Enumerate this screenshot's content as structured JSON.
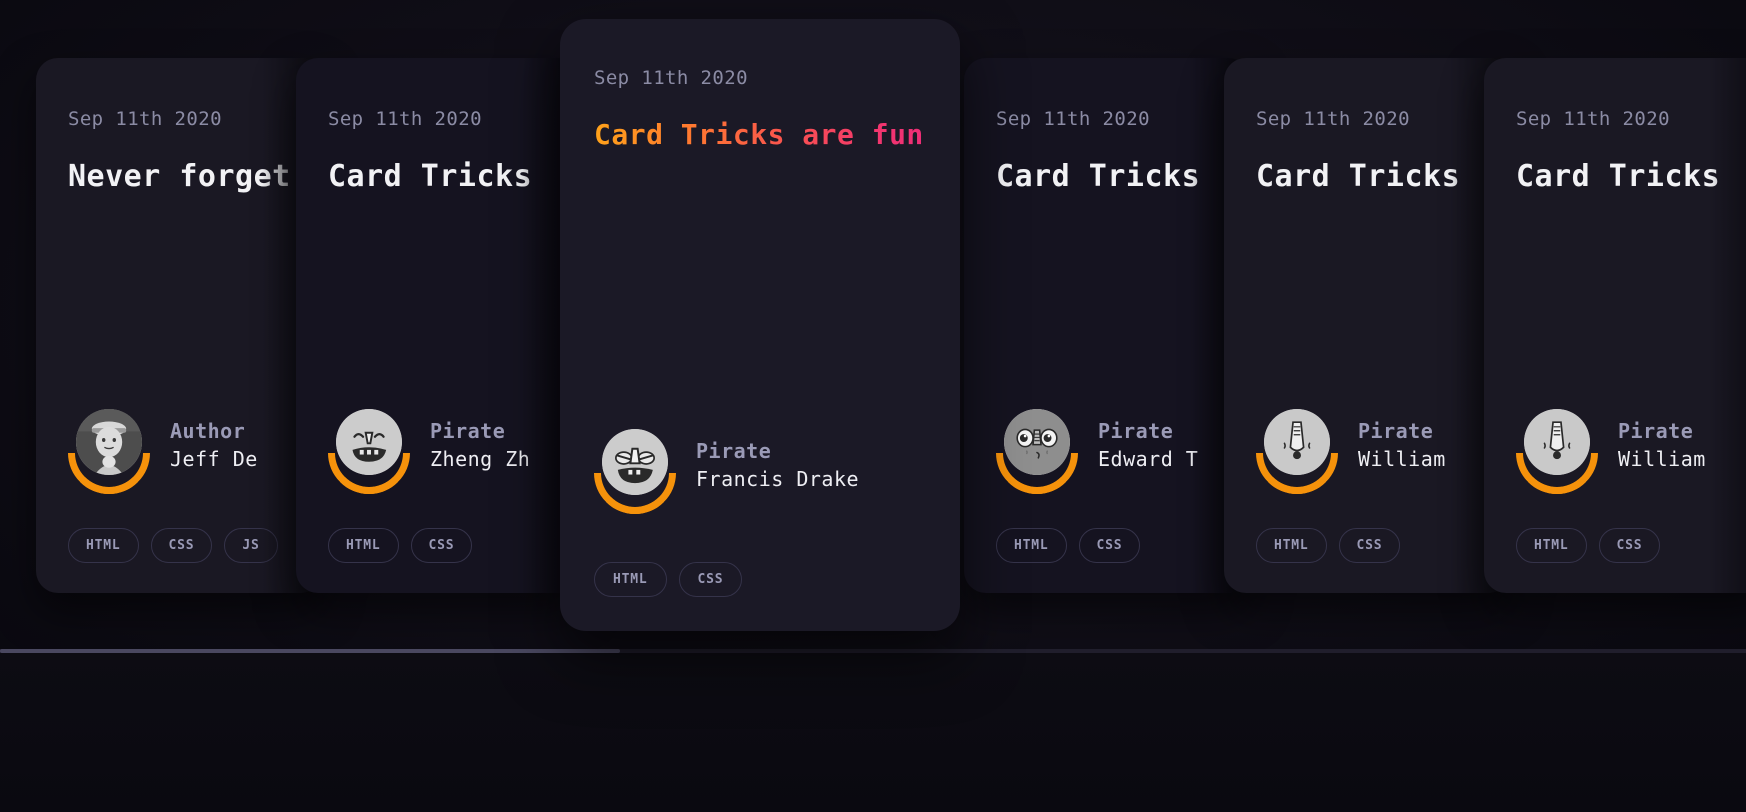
{
  "app": {
    "background_color": "#0a0910",
    "accent_color": "#f5920b",
    "card_color": "#1a1823",
    "active_card_color": "#1b1926",
    "title_gradient_from": "#ffa21a",
    "title_gradient_to": "#ee2d77"
  },
  "scrollbar": {
    "track_color": "#201e2c",
    "thumb_color": "#4a4860"
  },
  "cards": [
    {
      "date": "Sep 11th 2020",
      "title": "Never forget",
      "role": "Author",
      "name": "Jeff De",
      "avatar": "photo-avatar-icon",
      "tags": [
        "HTML",
        "CSS",
        "JS"
      ],
      "active": false
    },
    {
      "date": "Sep 11th 2020",
      "title": "Card Tricks",
      "role": "Pirate",
      "name": "Zheng Zh",
      "avatar": "pirate-face-grin-icon",
      "tags": [
        "HTML",
        "CSS"
      ],
      "active": false
    },
    {
      "date": "Sep 11th 2020",
      "title": "Card Tricks are fun!",
      "role": "Pirate",
      "name": "Francis Drake",
      "avatar": "pirate-face-smirk-icon",
      "tags": [
        "HTML",
        "CSS"
      ],
      "active": true
    },
    {
      "date": "Sep 11th 2020",
      "title": "Card Tricks",
      "role": "Pirate",
      "name": "Edward T",
      "avatar": "pirate-face-wide-eyes-icon",
      "tags": [
        "HTML",
        "CSS"
      ],
      "active": false
    },
    {
      "date": "Sep 11th 2020",
      "title": "Card Tricks",
      "role": "Pirate",
      "name": "William",
      "avatar": "pirate-face-long-nose-icon",
      "tags": [
        "HTML",
        "CSS"
      ],
      "active": false
    },
    {
      "date": "Sep 11th 2020",
      "title": "Card Tricks",
      "role": "Pirate",
      "name": "William",
      "avatar": "pirate-face-long-nose-icon",
      "tags": [
        "HTML",
        "CSS"
      ],
      "active": false
    }
  ]
}
